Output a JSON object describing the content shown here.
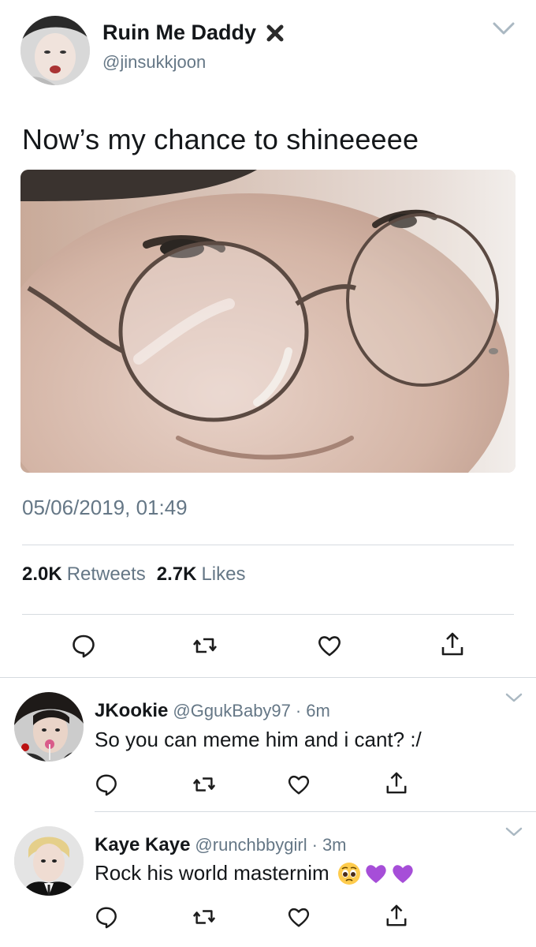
{
  "main_tweet": {
    "display_name": "Ruin Me Daddy",
    "name_badge_icon": "x-mark-icon",
    "handle": "@jinsukkjoon",
    "text": "Now’s my chance to shineeeee",
    "timestamp": "05/06/2019, 01:49",
    "retweets_count": "2.0K",
    "retweets_label": "Retweets",
    "likes_count": "2.7K",
    "likes_label": "Likes",
    "actions": [
      "reply-icon",
      "retweet-icon",
      "like-icon",
      "share-icon"
    ]
  },
  "replies": [
    {
      "display_name": "JKookie",
      "handle": "@GgukBaby97",
      "separator": "·",
      "time": "6m",
      "text": "So you can meme him and i cant? :/",
      "emojis": []
    },
    {
      "display_name": "Kaye Kaye",
      "handle": "@runchbbygirl",
      "separator": "·",
      "time": "3m",
      "text": "Rock his world masternim",
      "emojis": [
        "pleading-face-icon",
        "purple-heart-icon",
        "purple-heart-icon"
      ]
    }
  ],
  "colors": {
    "primary_text": "#14171a",
    "secondary_text": "#657786",
    "divider": "#d6dbe0",
    "icon": "#1c1c1c",
    "purple_heart": "#a64ed8"
  }
}
